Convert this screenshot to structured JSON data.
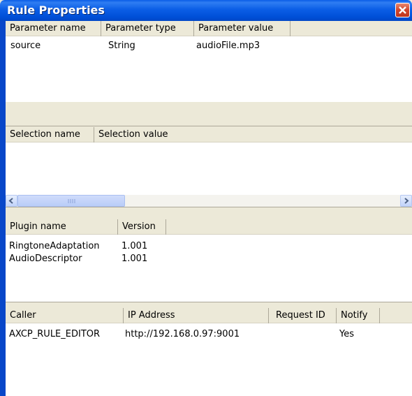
{
  "window": {
    "title": "Rule Properties"
  },
  "parameters": {
    "columns": [
      "Parameter name",
      "Parameter type",
      "Parameter value"
    ],
    "rows": [
      [
        "source",
        "String",
        "audioFile.mp3"
      ]
    ]
  },
  "selections": {
    "columns": [
      "Selection name",
      "Selection value"
    ],
    "rows": []
  },
  "plugins": {
    "columns": [
      "Plugin name",
      "Version"
    ],
    "rows": [
      [
        "RingtoneAdaptation",
        "1.001"
      ],
      [
        "AudioDescriptor",
        "1.001"
      ]
    ]
  },
  "callers": {
    "columns": [
      "Caller",
      "IP Address",
      "Request ID",
      "Notify"
    ],
    "rows": [
      [
        "AXCP_RULE_EDITOR",
        "http://192.168.0.97:9001",
        "",
        "Yes"
      ]
    ]
  },
  "icons": {
    "close": "close-icon",
    "scroll_left": "arrow-left-icon",
    "scroll_right": "arrow-right-icon",
    "scroll_grip": "grip-icon"
  }
}
